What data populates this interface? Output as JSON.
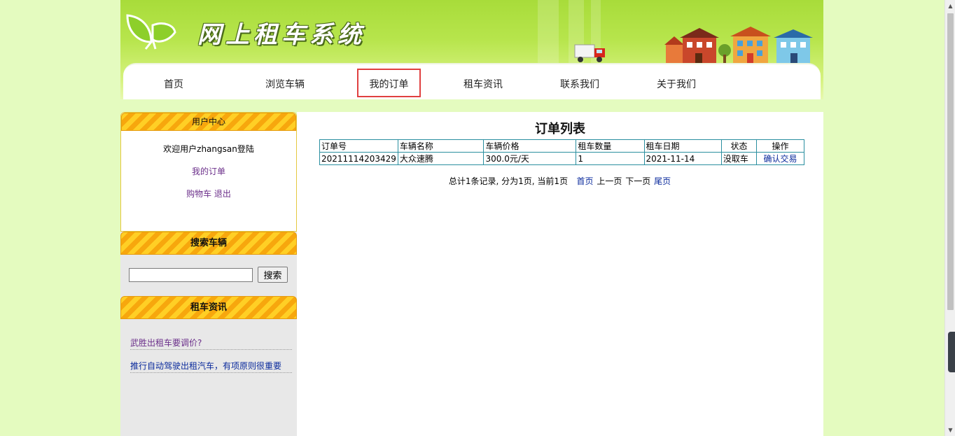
{
  "header": {
    "site_title": "网上租车系统",
    "nav": [
      {
        "label": "首页",
        "active": false
      },
      {
        "label": "浏览车辆",
        "active": false
      },
      {
        "label": "我的订单",
        "active": true
      },
      {
        "label": "租车资讯",
        "active": false
      },
      {
        "label": "联系我们",
        "active": false
      },
      {
        "label": "关于我们",
        "active": false
      }
    ]
  },
  "sidebar": {
    "user_center": {
      "title": "用户中心",
      "welcome": "欢迎用户zhangsan登陆",
      "my_orders": "我的订单",
      "cart": "购物车",
      "logout": "退出"
    },
    "search": {
      "title": "搜索车辆",
      "input_value": "",
      "button_label": "搜索"
    },
    "news": {
      "title": "租车资讯",
      "items": [
        "武胜出租车要调价?",
        "推行自动驾驶出租汽车，有项原则很重要"
      ]
    }
  },
  "main": {
    "title": "订单列表",
    "table": {
      "headers": [
        "订单号",
        "车辆名称",
        "车辆价格",
        "租车数量",
        "租车日期",
        "状态",
        "操作"
      ],
      "rows": [
        [
          "20211114203429",
          "大众速腾",
          "300.0元/天",
          "1",
          "2021-11-14",
          "没取车",
          "确认交易"
        ]
      ]
    },
    "pager": {
      "summary": "总计1条记录, 分为1页, 当前1页",
      "first": "首页",
      "prev": "上一页",
      "next": "下一页",
      "last": "尾页"
    }
  },
  "colors": {
    "page_bg": "#e4fbbf",
    "header_green": "#b7e54c",
    "box_orange": "#f7a70d",
    "table_border": "#2a8fa0",
    "active_outline": "#e04040"
  }
}
